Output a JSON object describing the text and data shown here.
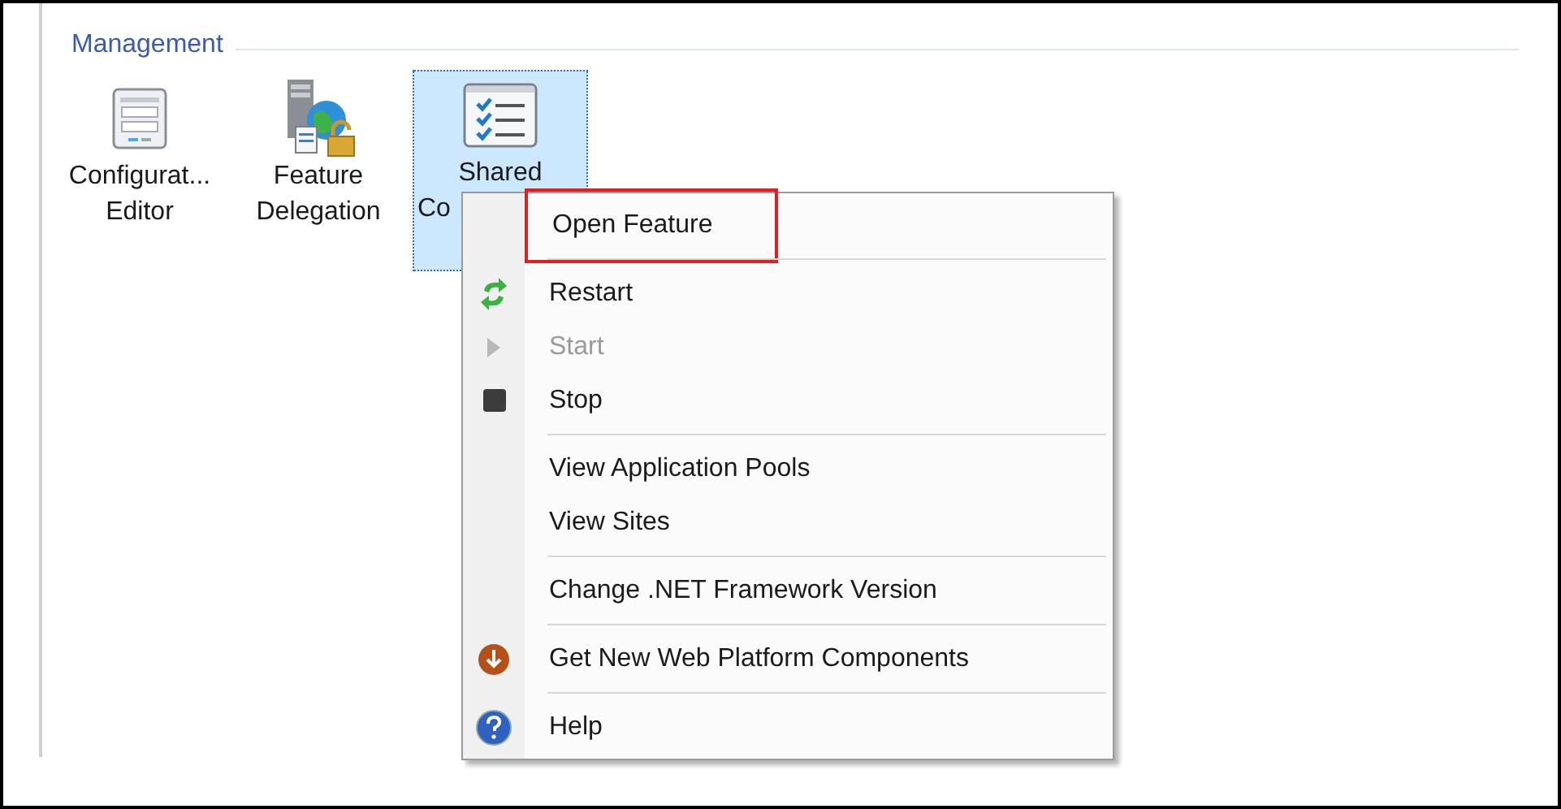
{
  "section": {
    "title": "Management"
  },
  "features": [
    {
      "kind": "config",
      "label_lines": [
        "Configurat...",
        "Editor"
      ],
      "selected": false
    },
    {
      "kind": "delegation",
      "label_lines": [
        "Feature",
        "Delegation"
      ],
      "selected": false
    },
    {
      "kind": "checklist",
      "label_lines": [
        "Shared",
        "Co"
      ],
      "selected": true
    }
  ],
  "context_menu": {
    "groups": [
      [
        {
          "label": "Open Feature",
          "highlighted": true,
          "disabled": false
        }
      ],
      [
        {
          "label": "Restart",
          "kind": "restart",
          "disabled": false
        },
        {
          "label": "Start",
          "kind": "start",
          "disabled": true
        },
        {
          "label": "Stop",
          "kind": "stop",
          "disabled": false
        }
      ],
      [
        {
          "label": "View Application Pools",
          "disabled": false
        },
        {
          "label": "View Sites",
          "disabled": false
        }
      ],
      [
        {
          "label": "Change .NET Framework Version",
          "disabled": false
        }
      ],
      [
        {
          "label": "Get New Web Platform Components",
          "kind": "download",
          "disabled": false
        }
      ],
      [
        {
          "label": "Help",
          "kind": "help",
          "disabled": false
        }
      ]
    ]
  }
}
